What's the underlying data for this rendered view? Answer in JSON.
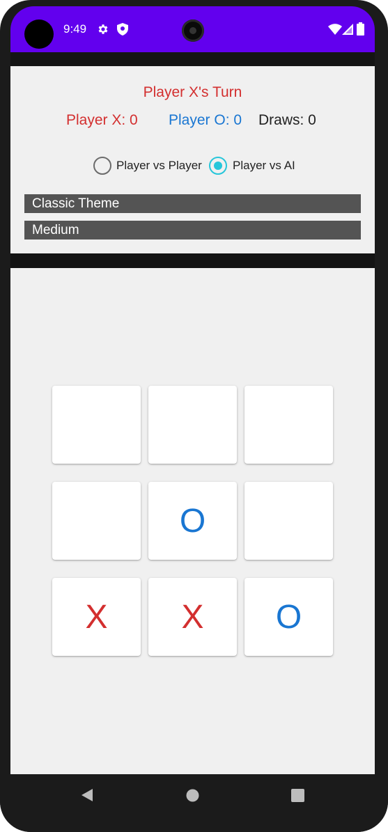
{
  "status_bar": {
    "time": "9:49",
    "bg_color": "#6200ee",
    "icons": [
      "settings-icon",
      "shield-icon",
      "wifi-icon",
      "signal-icon",
      "battery-icon"
    ]
  },
  "game": {
    "turn_text": "Player X's Turn",
    "score_x": "Player X: 0",
    "score_o": "Player O: 0",
    "draws": "Draws: 0",
    "mode_options": [
      {
        "label": "Player vs Player",
        "selected": false
      },
      {
        "label": "Player vs AI",
        "selected": true
      }
    ],
    "theme_value": "Classic Theme",
    "difficulty_value": "Medium",
    "colors": {
      "x": "#d32f2f",
      "o": "#1976d2",
      "accent": "#26c6da"
    }
  },
  "board": {
    "cells": [
      "",
      "",
      "",
      "",
      "O",
      "",
      "X",
      "X",
      "O"
    ]
  },
  "nav": {
    "icons": [
      "back-icon",
      "home-icon",
      "recents-icon"
    ]
  }
}
